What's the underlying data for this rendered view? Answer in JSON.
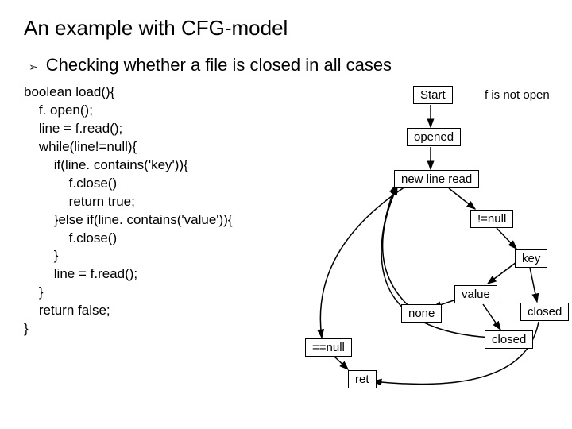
{
  "title": "An example with CFG-model",
  "bullet_glyph": "➢",
  "subtitle": "Checking whether a file is closed in all cases",
  "code": "boolean load(){\n    f. open();\n    line = f.read();\n    while(line!=null){\n        if(line. contains('key')){\n            f.close()\n            return true;\n        }else if(line. contains('value')){\n            f.close()\n        }\n        line = f.read();\n    }\n    return false;\n}",
  "nodes": {
    "start": "Start",
    "opened": "opened",
    "newline": "new line read",
    "key": "key",
    "value": "value",
    "closed1": "closed",
    "closed2": "closed",
    "ret": "ret"
  },
  "labels": {
    "fnotopen": "f is not open",
    "nenull": "!=null",
    "none": "none",
    "eqnull": "==null"
  }
}
